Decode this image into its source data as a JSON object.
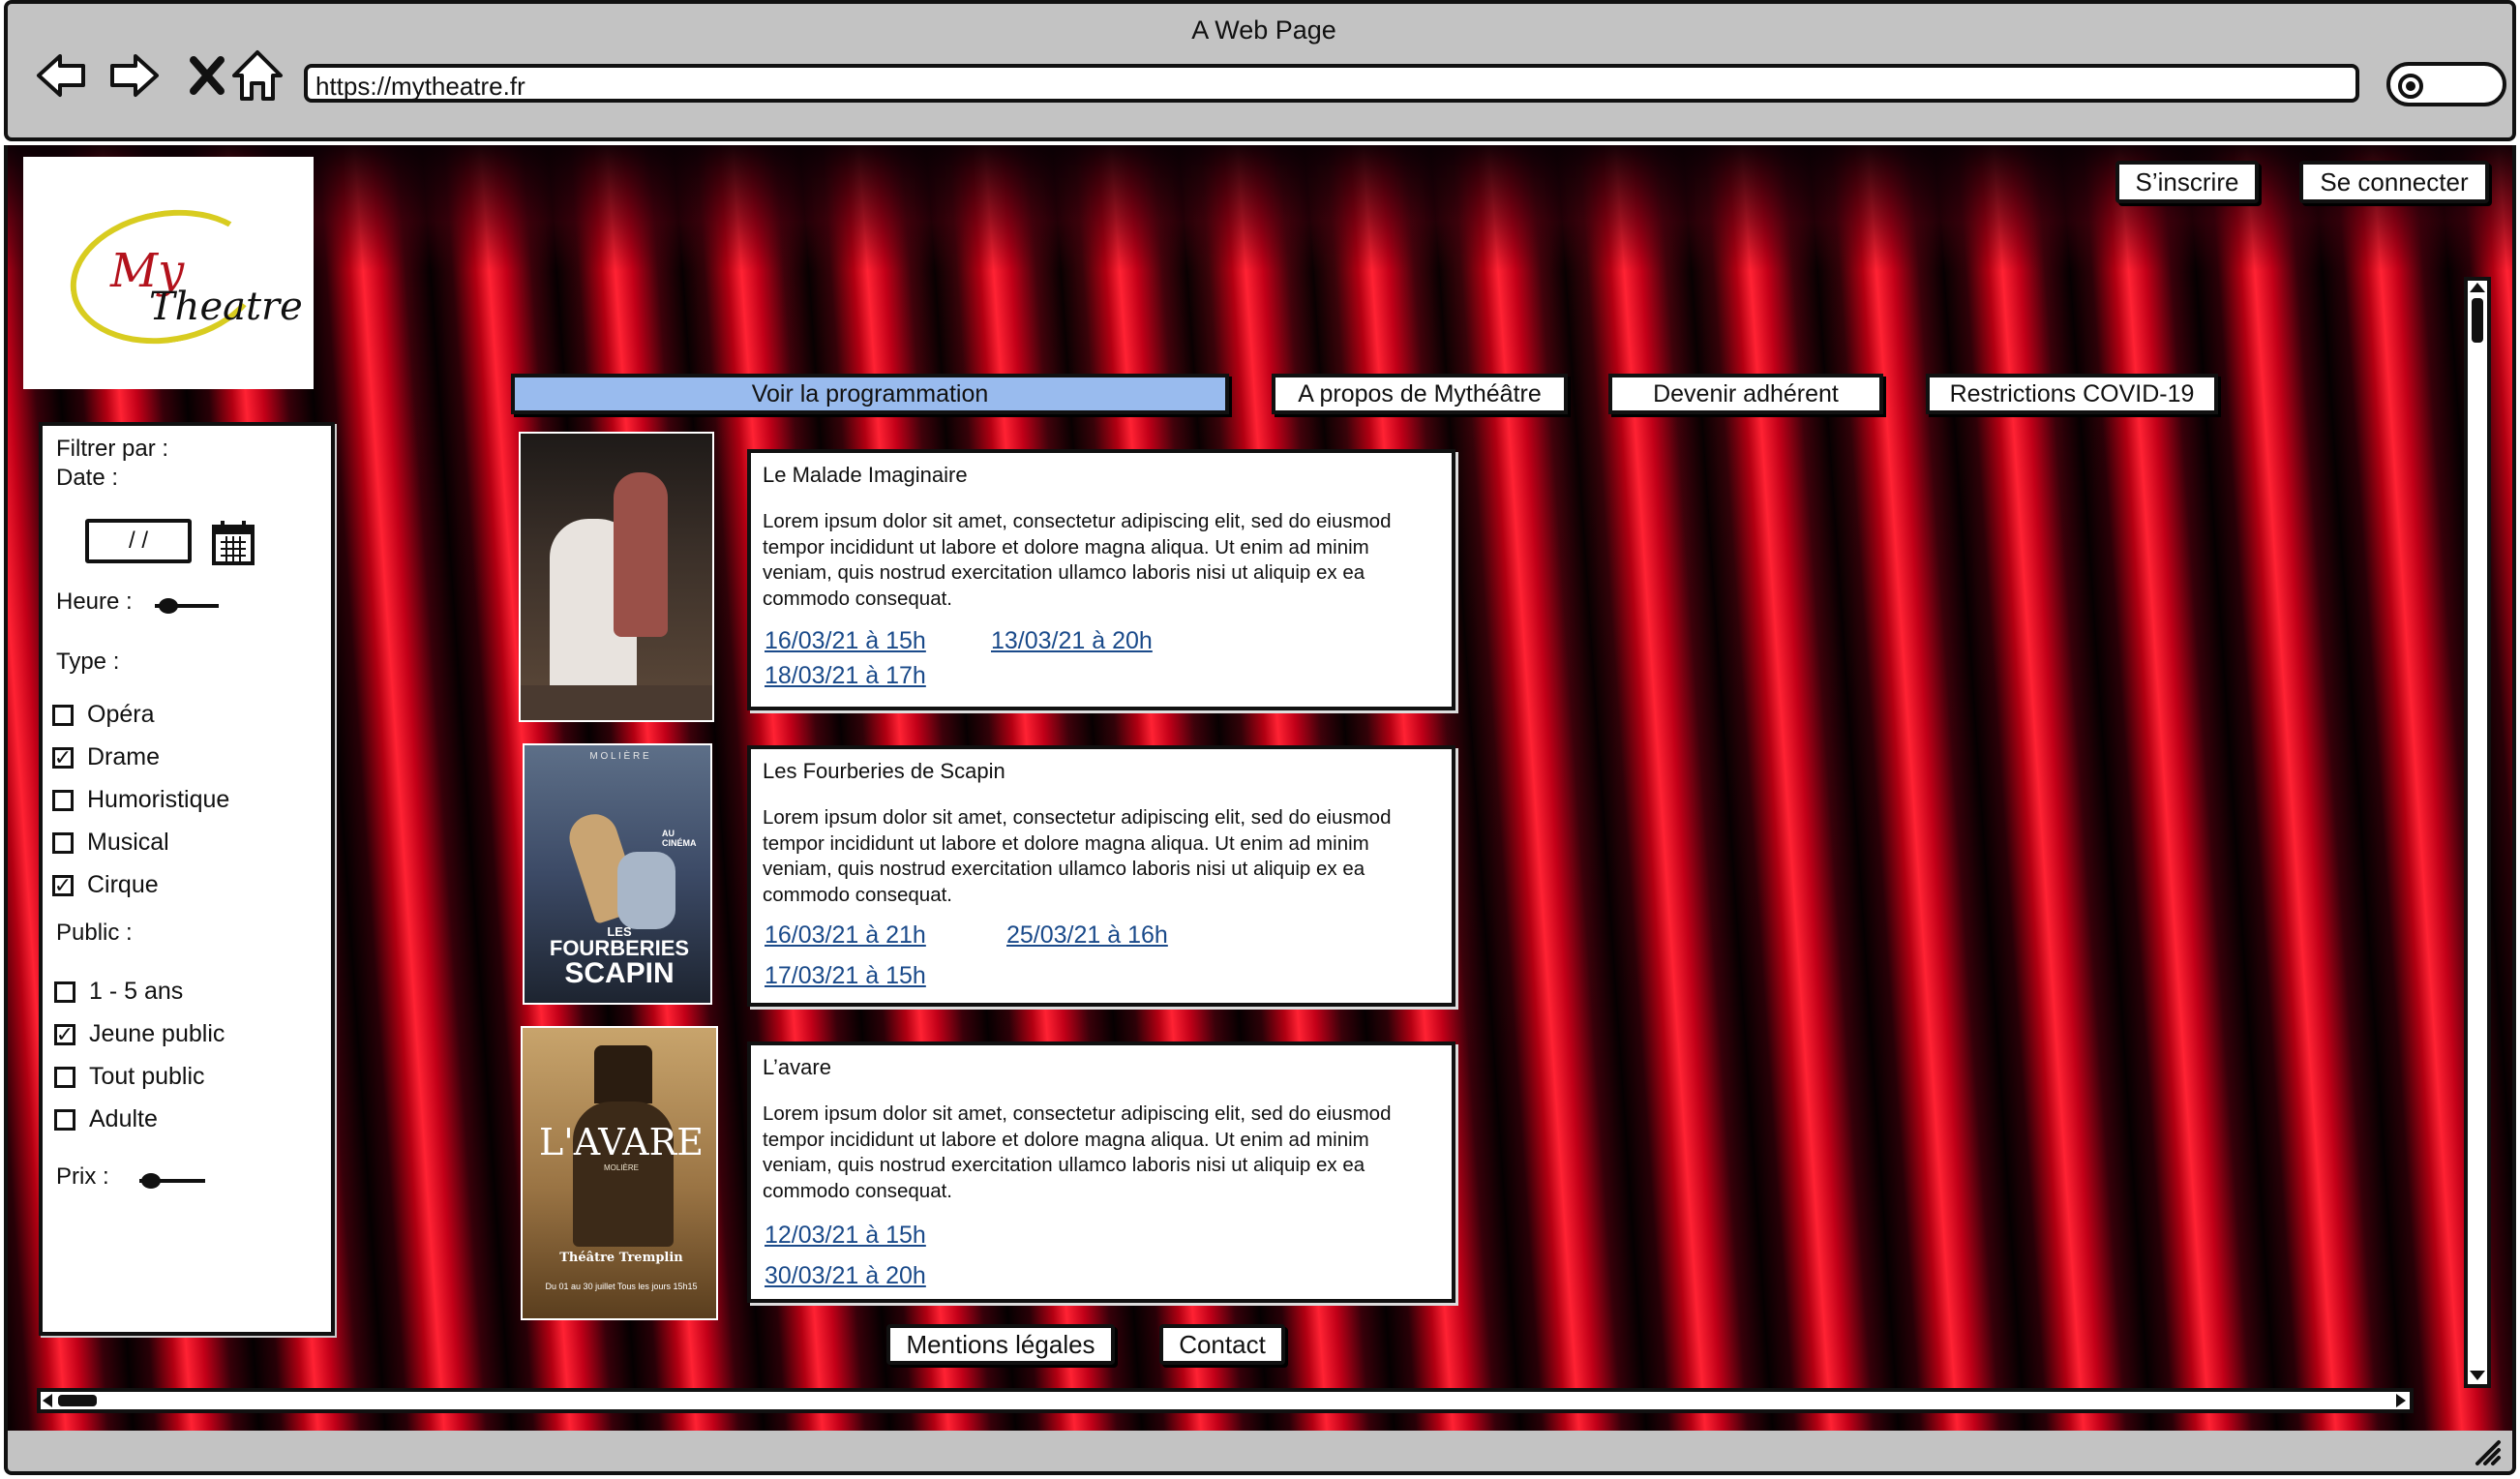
{
  "window": {
    "title": "A Web Page",
    "url": "https://mytheatre.fr"
  },
  "icons": {
    "back": "back-arrow-icon",
    "forward": "forward-arrow-icon",
    "stop": "close-icon",
    "home": "home-icon",
    "search": "search-icon",
    "calendar": "calendar-icon"
  },
  "auth": {
    "signup": "S’inscrire",
    "login": "Se connecter"
  },
  "logo": {
    "line1": "My",
    "line2": "Theatre"
  },
  "colors": {
    "active_tab": "#99bbee",
    "link": "#1a4a8a",
    "logo_red": "#b3121c",
    "logo_ring": "#d8cc20"
  },
  "tabs": [
    {
      "label": "Voir la programmation",
      "active": true
    },
    {
      "label": "A propos de Mythéâtre",
      "active": false
    },
    {
      "label": "Devenir adhérent",
      "active": false
    },
    {
      "label": "Restrictions COVID-19",
      "active": false
    }
  ],
  "filter": {
    "title": "Filtrer par :",
    "date_label": "Date :",
    "date_value": "/ /",
    "hour_label": "Heure :",
    "type_label": "Type :",
    "types": [
      {
        "label": "Opéra",
        "checked": false
      },
      {
        "label": "Drame",
        "checked": true
      },
      {
        "label": "Humoristique",
        "checked": false
      },
      {
        "label": "Musical",
        "checked": false
      },
      {
        "label": "Cirque",
        "checked": true
      }
    ],
    "public_label": "Public :",
    "publics": [
      {
        "label": "1 - 5 ans",
        "checked": false
      },
      {
        "label": "Jeune public",
        "checked": true
      },
      {
        "label": "Tout public",
        "checked": false
      },
      {
        "label": "Adulte",
        "checked": false
      }
    ],
    "price_label": "Prix :"
  },
  "shows": [
    {
      "title": "Le Malade Imaginaire",
      "description": "Lorem ipsum dolor sit amet, consectetur adipiscing elit, sed do eiusmod tempor incididunt ut labore et dolore magna aliqua. Ut enim ad minim veniam, quis nostrud exercitation ullamco laboris nisi ut aliquip ex ea commodo consequat.",
      "dates": [
        "16/03/21 à 15h",
        "13/03/21 à 20h",
        "18/03/21 à 17h"
      ]
    },
    {
      "title": "Les Fourberies de Scapin",
      "description": "Lorem ipsum dolor sit amet, consectetur adipiscing elit, sed do eiusmod tempor incididunt ut labore et dolore magna aliqua. Ut enim ad minim veniam, quis nostrud exercitation ullamco laboris nisi ut aliquip ex ea commodo consequat.",
      "dates": [
        "16/03/21 à 21h",
        "25/03/21 à 16h",
        "17/03/21 à 15h"
      ],
      "poster": {
        "header": "M O L I È R E",
        "line1": "LES",
        "line2": "FOURBERIES",
        "line3": "SCAPIN",
        "badge": "AU CINÉMA"
      }
    },
    {
      "title": "L’avare",
      "description": "Lorem ipsum dolor sit amet, consectetur adipiscing elit, sed do eiusmod tempor incididunt ut labore et dolore magna aliqua. Ut enim ad minim veniam, quis nostrud exercitation ullamco laboris nisi ut aliquip ex ea commodo consequat.",
      "dates": [
        "12/03/21 à 15h",
        "30/03/21 à 20h"
      ],
      "poster": {
        "title": "L'AVARE",
        "subtitle": "MOLIÈRE",
        "venue": "Théâtre Tremplin",
        "dates": "Du 01 au 30 juillet Tous les jours 15h15"
      }
    }
  ],
  "footer": {
    "legal": "Mentions légales",
    "contact": "Contact"
  }
}
